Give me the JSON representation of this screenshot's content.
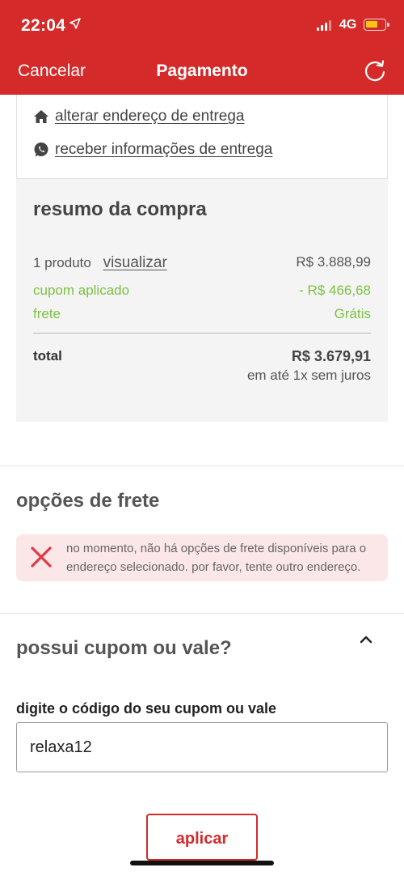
{
  "status_bar": {
    "time": "22:04",
    "network": "4G"
  },
  "nav": {
    "cancel_label": "Cancelar",
    "title": "Pagamento"
  },
  "address": {
    "change_label": "alterar endereço de entrega",
    "info_label": "receber informações de entrega"
  },
  "summary": {
    "title": "resumo da compra",
    "products_label": "1 produto",
    "view_label": "visualizar",
    "products_value": "R$ 3.888,99",
    "coupon_label": "cupom aplicado",
    "coupon_value": "- R$ 466,68",
    "shipping_label": "frete",
    "shipping_value": "Grátis",
    "total_label": "total",
    "total_value": "R$ 3.679,91",
    "installments": "em até 1x sem juros"
  },
  "shipping_options": {
    "title": "opções de frete",
    "alert_text": "no momento, não há opções de frete disponíveis para o endereço selecionado. por favor, tente outro endereço."
  },
  "coupon": {
    "title": "possui cupom ou vale?",
    "field_label": "digite o código do seu cupom ou vale",
    "field_value": "relaxa12",
    "apply_label": "aplicar"
  },
  "colors": {
    "brand_red": "#d42a2a",
    "success_green": "#7cc242",
    "alert_bg": "#fbe6e8"
  }
}
